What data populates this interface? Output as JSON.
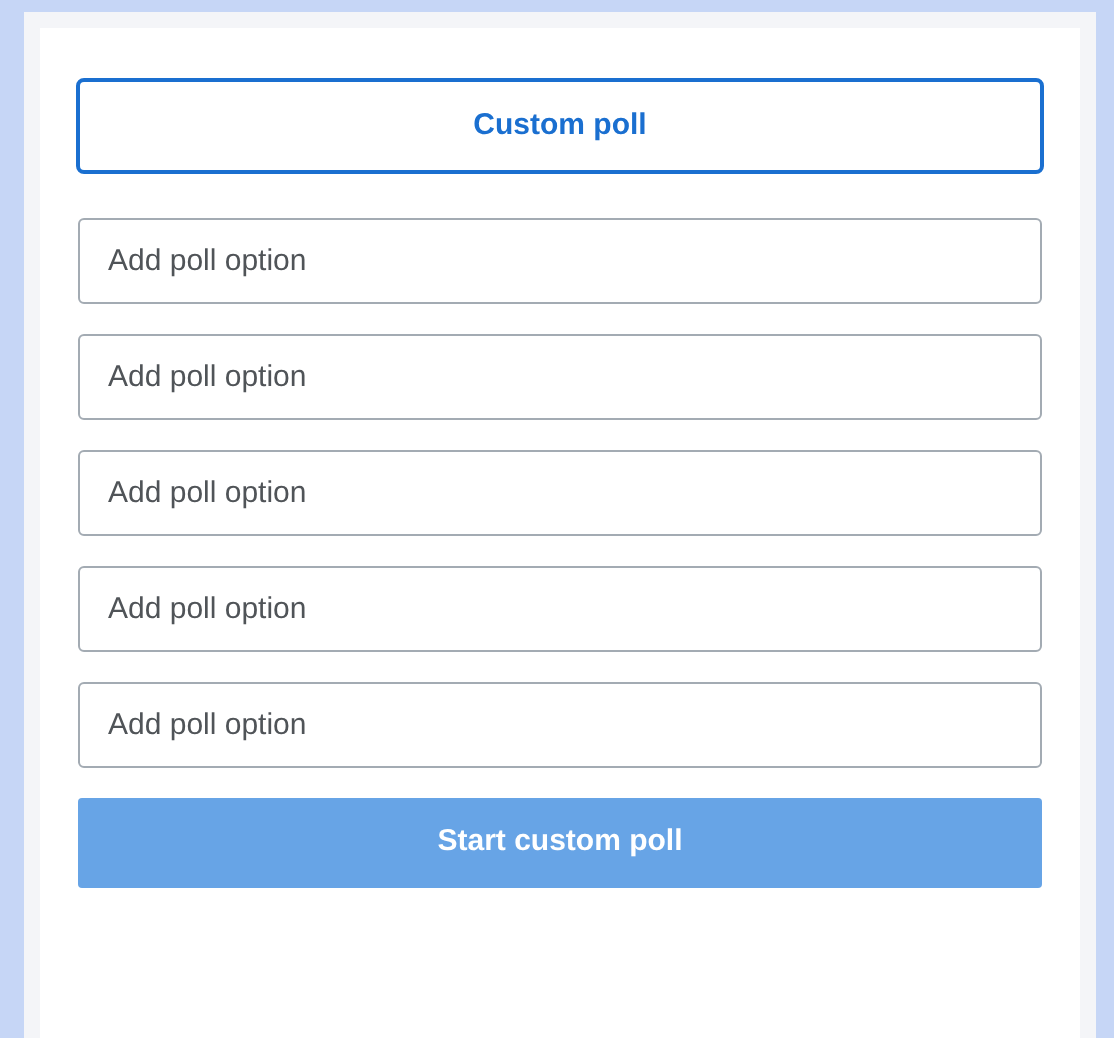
{
  "poll_type_button": {
    "label": "Custom poll",
    "selected": true
  },
  "options": [
    {
      "placeholder": "Add poll option"
    },
    {
      "placeholder": "Add poll option"
    },
    {
      "placeholder": "Add poll option"
    },
    {
      "placeholder": "Add poll option"
    },
    {
      "placeholder": "Add poll option"
    }
  ],
  "start_button": {
    "label": "Start custom poll",
    "disabled": true
  }
}
